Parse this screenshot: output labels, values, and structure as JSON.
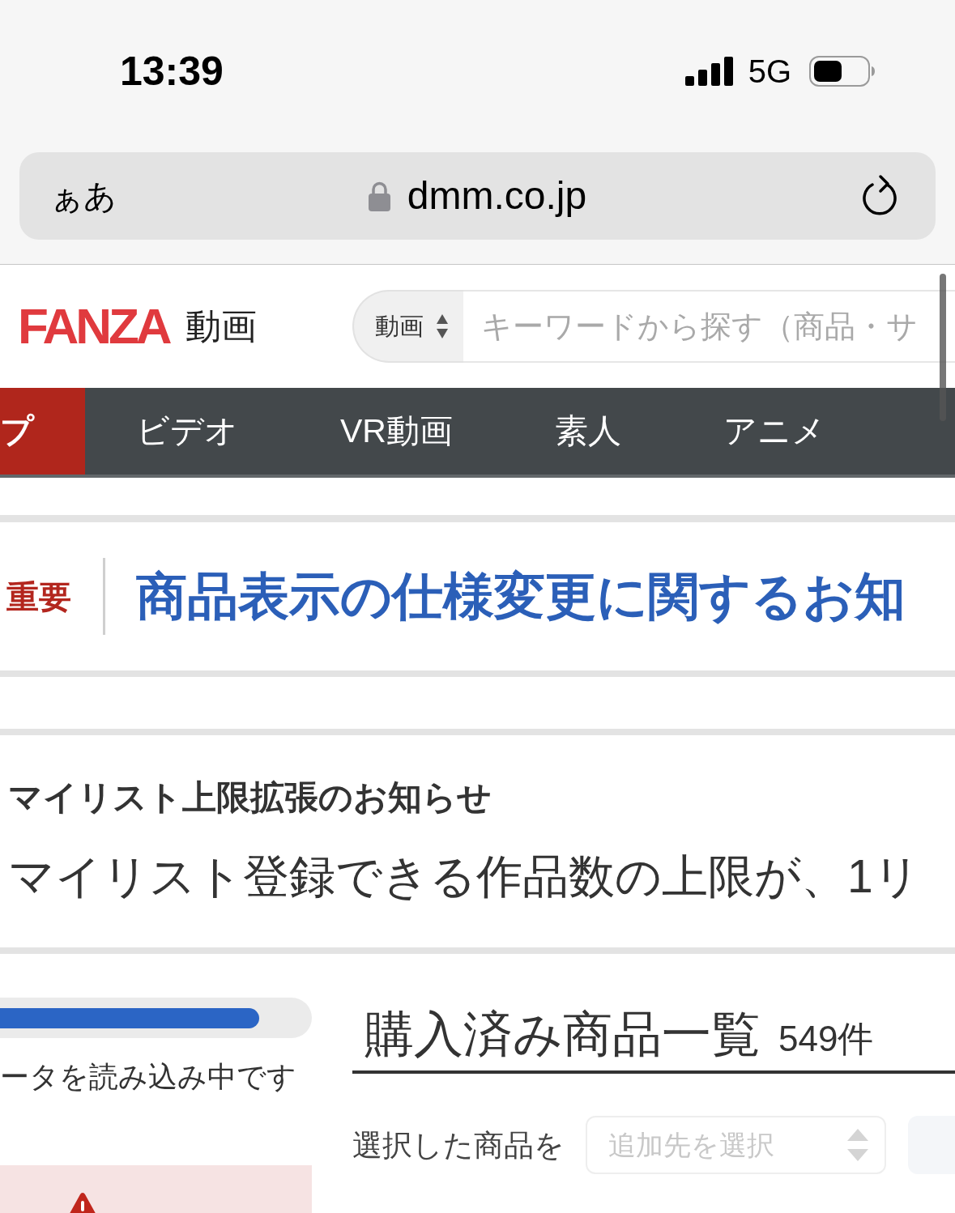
{
  "status_bar": {
    "time": "13:39",
    "network": "5G"
  },
  "browser": {
    "text_size_button": "ぁあ",
    "url": "dmm.co.jp"
  },
  "header": {
    "logo": "FANZA",
    "section": "動画",
    "search": {
      "category": "動画",
      "placeholder": "キーワードから探す（商品・サ"
    }
  },
  "nav_tabs": [
    {
      "label": "プ",
      "selected": true
    },
    {
      "label": "ビデオ",
      "selected": false
    },
    {
      "label": "VR動画",
      "selected": false
    },
    {
      "label": "素人",
      "selected": false
    },
    {
      "label": "アニメ",
      "selected": false
    }
  ],
  "important_notice": {
    "badge": "重要",
    "title": "商品表示の仕様変更に関するお知"
  },
  "mylist_notice": {
    "title": "マイリスト上限拡張のお知らせ",
    "body": "マイリスト登録できる作品数の上限が、1リ"
  },
  "loading": {
    "level": 0.83,
    "message": "ータを読み込み中です"
  },
  "purchases": {
    "title": "購入済み商品一覧",
    "count": "549件",
    "action_label": "選択した商品を",
    "target_select": {
      "placeholder": "追加先を選択"
    },
    "move_button": {
      "disabled": true
    }
  }
}
